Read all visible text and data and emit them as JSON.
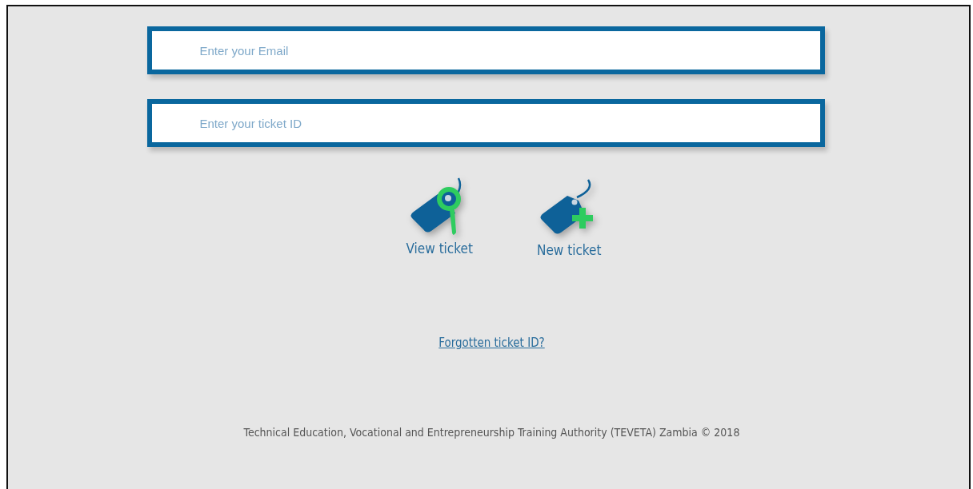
{
  "fields": [
    {
      "placeholder": "Enter your Email"
    },
    {
      "placeholder": "Enter your ticket ID"
    }
  ],
  "actions": [
    {
      "kind": "view",
      "label": "View ticket"
    },
    {
      "kind": "new",
      "label": "New ticket"
    }
  ],
  "forgot_link": "Forgotten ticket ID?",
  "footer": "Technical Education, Vocational and Entrepreneurship Training Authority (TEVETA) Zambia © 2018"
}
